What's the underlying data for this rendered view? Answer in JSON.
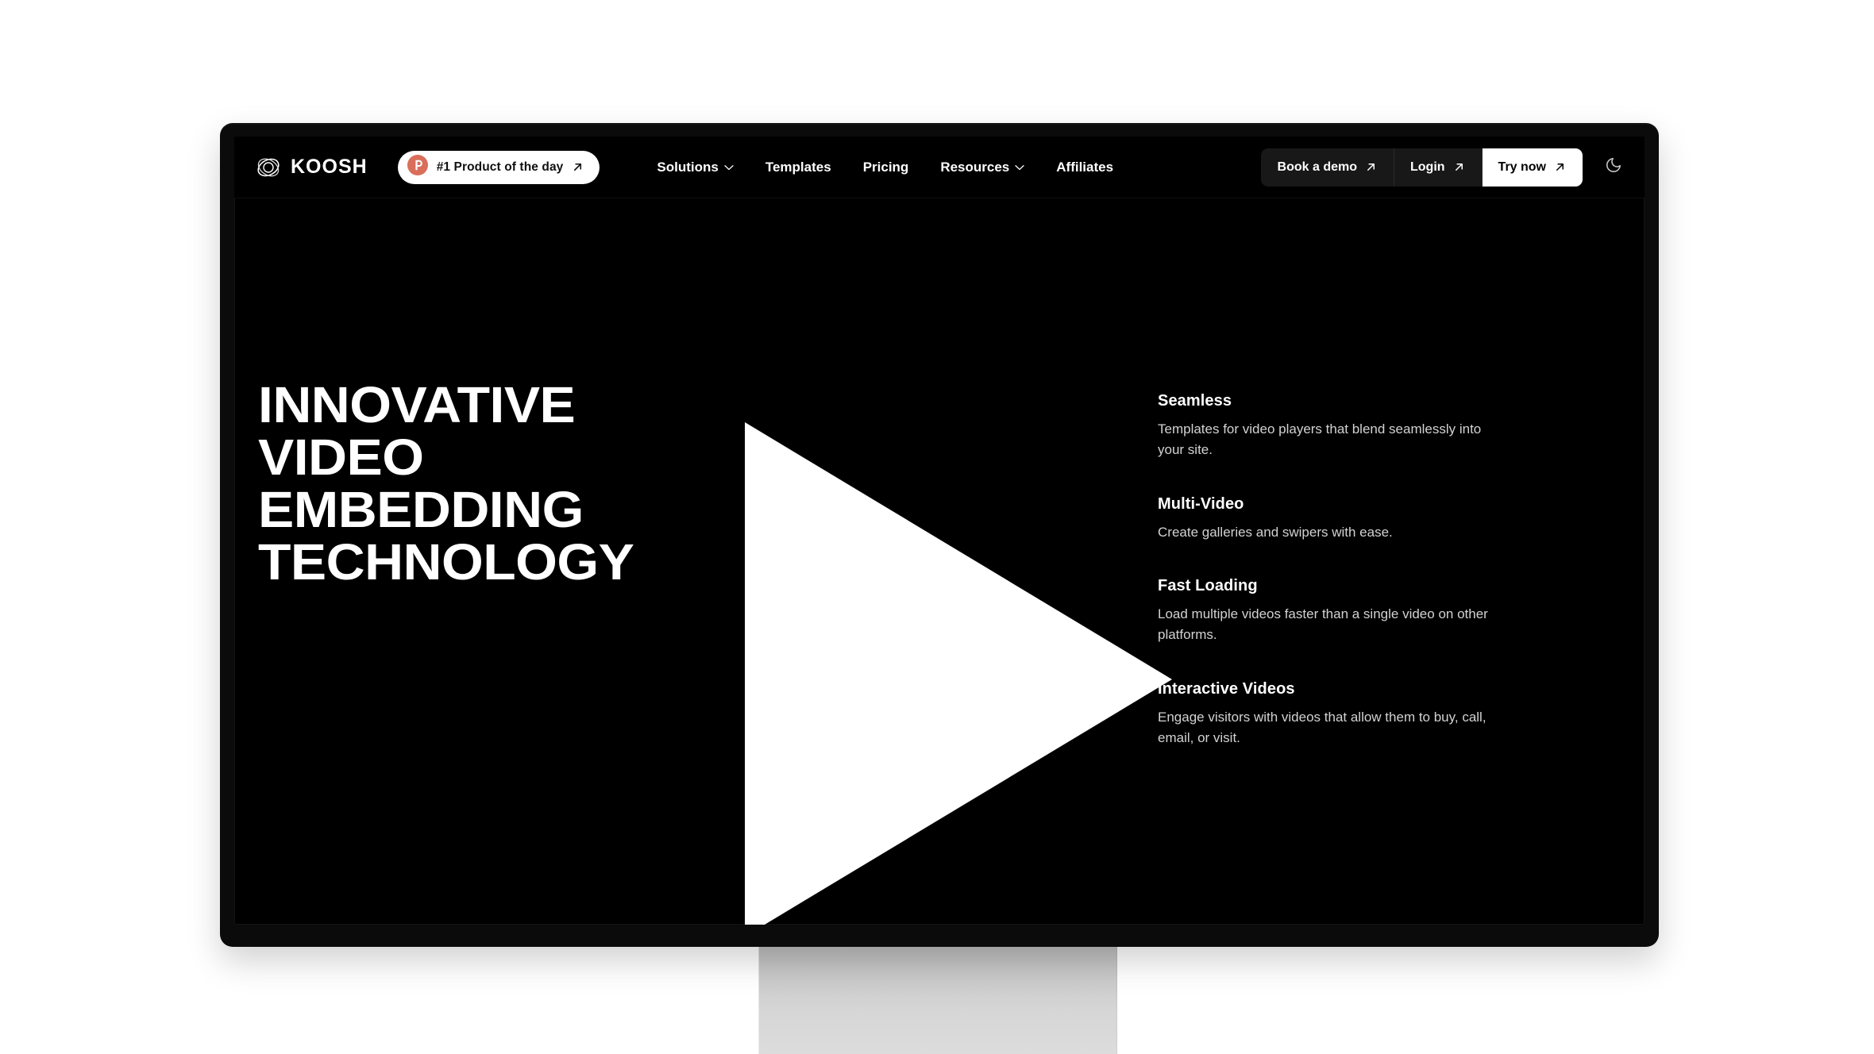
{
  "brand": {
    "name": "KOOSH",
    "logo_icon": "koosh-swirl-logo-icon"
  },
  "badge": {
    "label": "#1 Product of the day",
    "icon": "product-hunt-icon",
    "arrow_icon": "arrow-up-right-icon",
    "icon_color": "#d96e5b",
    "background": "#ffffff"
  },
  "nav": {
    "links": [
      {
        "label": "Solutions",
        "has_dropdown": true
      },
      {
        "label": "Templates",
        "has_dropdown": false
      },
      {
        "label": "Pricing",
        "has_dropdown": false
      },
      {
        "label": "Resources",
        "has_dropdown": true
      },
      {
        "label": "Affiliates",
        "has_dropdown": false
      }
    ],
    "actions": [
      {
        "label": "Book a demo",
        "style": "dark",
        "arrow_icon": "arrow-up-right-icon"
      },
      {
        "label": "Login",
        "style": "dark",
        "arrow_icon": "arrow-up-right-icon"
      },
      {
        "label": "Try now",
        "style": "primary",
        "arrow_icon": "arrow-up-right-icon"
      }
    ],
    "theme_toggle_icon": "moon-icon"
  },
  "hero": {
    "title": "INNOVATIVE\nVIDEO\nEMBEDDING\nTECHNOLOGY",
    "play_icon": "play-triangle-icon",
    "features": [
      {
        "title": "Seamless",
        "desc": "Templates for video players that blend seamlessly into your site."
      },
      {
        "title": "Multi-Video",
        "desc": "Create galleries and swipers with ease."
      },
      {
        "title": "Fast Loading",
        "desc": "Load multiple videos faster than a single video on other platforms."
      },
      {
        "title": "Interactive Videos",
        "desc": "Engage visitors with videos that allow them to buy, call, email, or visit."
      }
    ]
  },
  "device": {
    "type": "desktop-monitor",
    "screen_background": "#000000"
  }
}
